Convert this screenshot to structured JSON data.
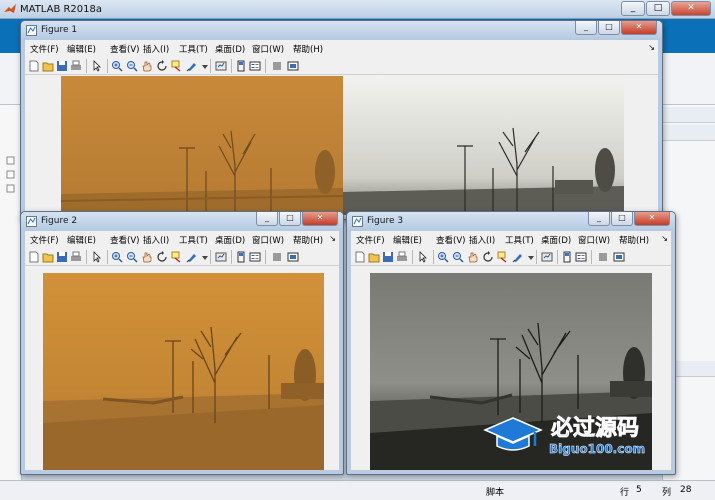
{
  "main_window": {
    "title": "MATLAB R2018a",
    "status_label": "脚本",
    "row_label": "行",
    "row_value": "5",
    "col_label": "列",
    "col_value": "28"
  },
  "figure_menu": [
    "文件(F)",
    "编辑(E)",
    "查看(V)",
    "插入(I)",
    "工具(T)",
    "桌面(D)",
    "窗口(W)",
    "帮助(H)"
  ],
  "toolbar_icons": [
    "new-figure-icon",
    "open-file-icon",
    "save-icon",
    "print-icon",
    "pointer-icon",
    "zoom-in-icon",
    "zoom-out-icon",
    "pan-hand-icon",
    "rotate-icon",
    "data-cursor-icon",
    "brush-icon",
    "brush-dropdown-icon",
    "link-plot-icon",
    "colorbar-icon",
    "legend-icon",
    "hide-plot-tools-icon",
    "show-plot-tools-icon"
  ],
  "figures": [
    {
      "title": "Figure 1",
      "content": "original hazy image and enhanced image side by side"
    },
    {
      "title": "Figure 2",
      "content": "original dusty image"
    },
    {
      "title": "Figure 3",
      "content": "grayscale enhanced image"
    }
  ],
  "window_controls": {
    "minimize": "_",
    "maximize": "□",
    "close": "✕"
  },
  "watermark": {
    "main": "必过源码",
    "sub": "Biguo100.com"
  },
  "colors": {
    "ribbon_blue": "#0a70b8",
    "title_gradient_top": "#d5e3f2",
    "title_gradient_bottom": "#b4c9e1",
    "close_red": "#c43b27",
    "sand_sky": "#c98c38",
    "sand_ground": "#a26f2e",
    "watermark_blue": "#1e7ad6"
  }
}
